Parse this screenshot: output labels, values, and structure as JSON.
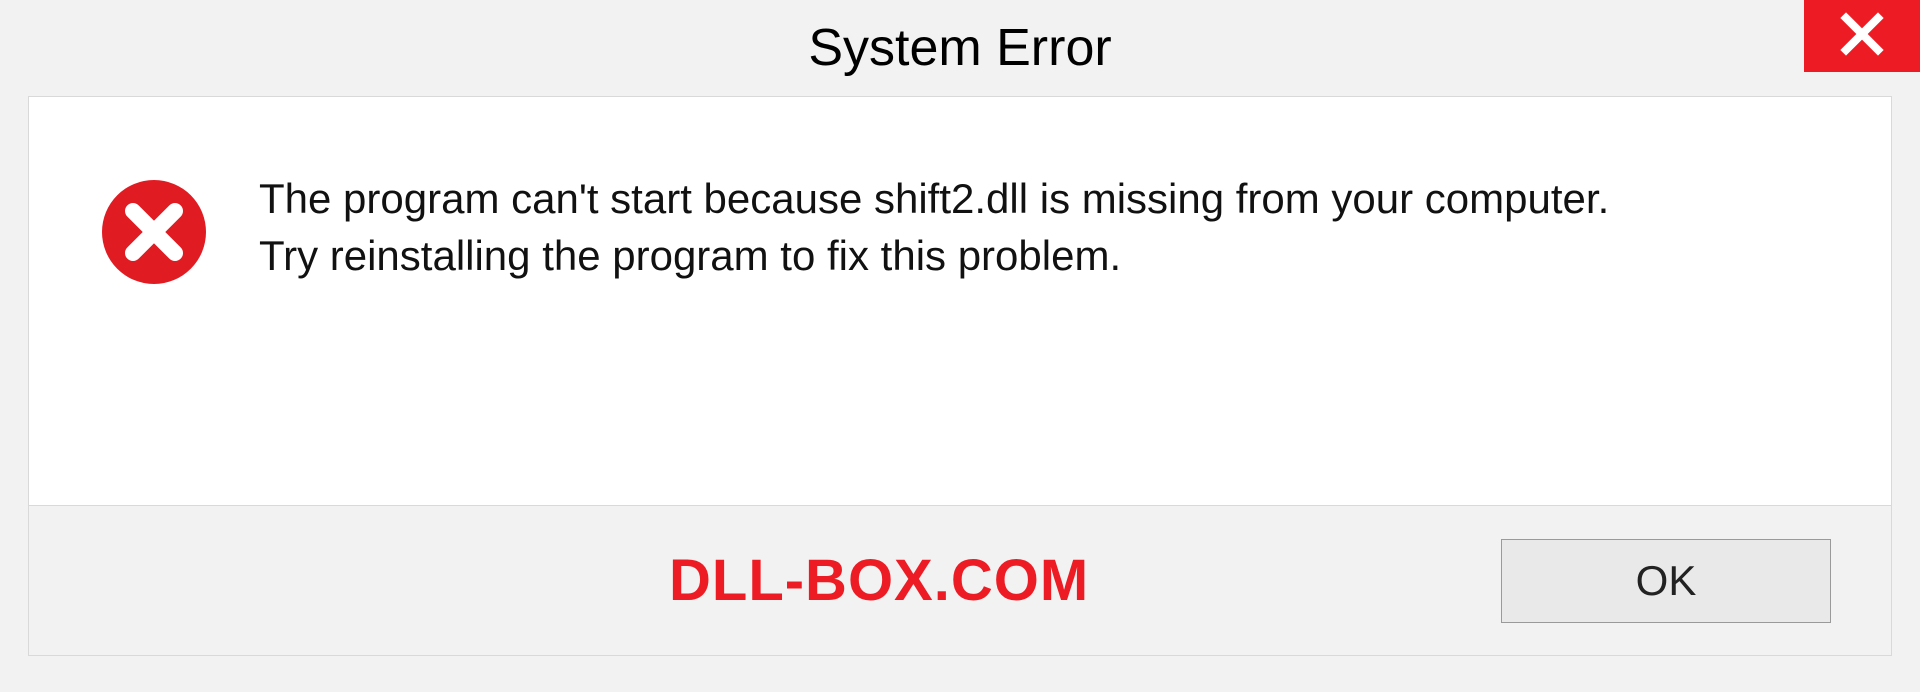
{
  "titlebar": {
    "title": "System Error"
  },
  "dialog": {
    "message": "The program can't start because shift2.dll is missing from your computer.\nTry reinstalling the program to fix this problem."
  },
  "footer": {
    "watermark": "DLL-BOX.COM",
    "ok_label": "OK"
  },
  "colors": {
    "accent_red": "#ed1c24"
  }
}
